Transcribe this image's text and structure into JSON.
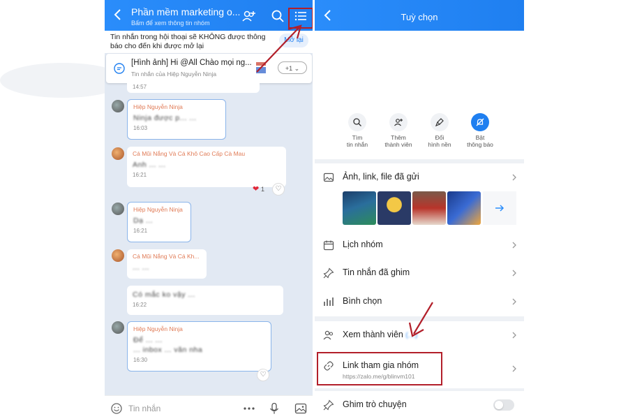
{
  "chat": {
    "title": "Phần mềm marketing o...",
    "subtitle": "Bấm để xem thông tin nhóm",
    "notice": "Tin nhắn trong hội thoại sẽ KHÔNG được thông báo cho đến khi được mở lại",
    "notice_button": "Mở lại",
    "pinned": {
      "title": "[Hình ảnh] Hi @All Chào mọi ng...",
      "subtitle": "Tin nhắn của Hiệp Nguyễn Ninja",
      "more": "+1"
    },
    "messages": [
      {
        "sender": "",
        "body": "",
        "time": "14:57"
      },
      {
        "sender": "Hiệp Nguyễn Ninja",
        "body": "Ninja được p... ...",
        "time": "16:03"
      },
      {
        "sender": "Cá Mũi Nắng Và Cá Khô Cao Cấp Cà Mau",
        "body": "Anh ... ...",
        "time": "16:21",
        "reaction_count": "1"
      },
      {
        "sender": "Hiệp Nguyễn Ninja",
        "body": "Dạ ...",
        "time": "16:21"
      },
      {
        "sender": "Cá Mũi Nắng Và Cá Kh...",
        "body": "... ...",
        "time": ""
      },
      {
        "sender": "",
        "body": "Có mắc ko vậy ...",
        "time": "16:22"
      },
      {
        "sender": "Hiệp Nguyễn Ninja",
        "body": "Để ... ...",
        "body2": "... inbox ... văn nha",
        "time": "16:30"
      }
    ],
    "input_placeholder": "Tin nhắn"
  },
  "options": {
    "title": "Tuỳ chọn",
    "quick_actions": [
      {
        "label": "Tìm\ntin nhắn",
        "icon": "search-icon"
      },
      {
        "label": "Thêm\nthành viên",
        "icon": "add-member-icon"
      },
      {
        "label": "Đổi\nhình nền",
        "icon": "brush-icon"
      },
      {
        "label": "Bật\nthông báo",
        "icon": "bell-off-icon"
      }
    ],
    "media_label": "Ảnh, link, file đã gửi",
    "rows": [
      {
        "label": "Lịch nhóm",
        "icon": "calendar-icon"
      },
      {
        "label": "Tin nhắn đã ghim",
        "icon": "pin-icon"
      },
      {
        "label": "Bình chọn",
        "icon": "poll-icon"
      }
    ],
    "members": {
      "label": "Xem thành viên",
      "count": "(...)"
    },
    "join_link": {
      "label": "Link tham gia nhóm",
      "url": "https://zalo.me/g/blinvm101"
    },
    "pin_chat": {
      "label": "Ghim trò chuyện",
      "enabled": false
    }
  },
  "colors": {
    "brand_blue": "#1f7ff0",
    "annotation_red": "#b21f2a",
    "chat_bg": "#e2e9f3"
  }
}
